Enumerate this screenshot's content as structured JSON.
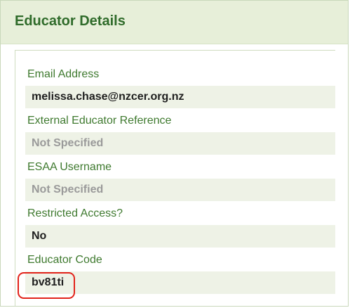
{
  "panel": {
    "title": "Educator Details"
  },
  "fields": [
    {
      "label": "Email Address",
      "value": "melissa.chase@nzcer.org.nz",
      "muted": false
    },
    {
      "label": "External Educator Reference",
      "value": "Not Specified",
      "muted": true
    },
    {
      "label": "ESAA Username",
      "value": "Not Specified",
      "muted": true
    },
    {
      "label": "Restricted Access?",
      "value": "No",
      "muted": false
    },
    {
      "label": "Educator Code",
      "value": "bv81ti",
      "muted": false
    }
  ],
  "colors": {
    "header_bg": "#e7efd9",
    "title": "#2f6b2a",
    "label": "#3f7a2f",
    "value_bg": "#eef2e6",
    "muted_value": "#9a9a9a",
    "highlight": "#e2231a"
  }
}
